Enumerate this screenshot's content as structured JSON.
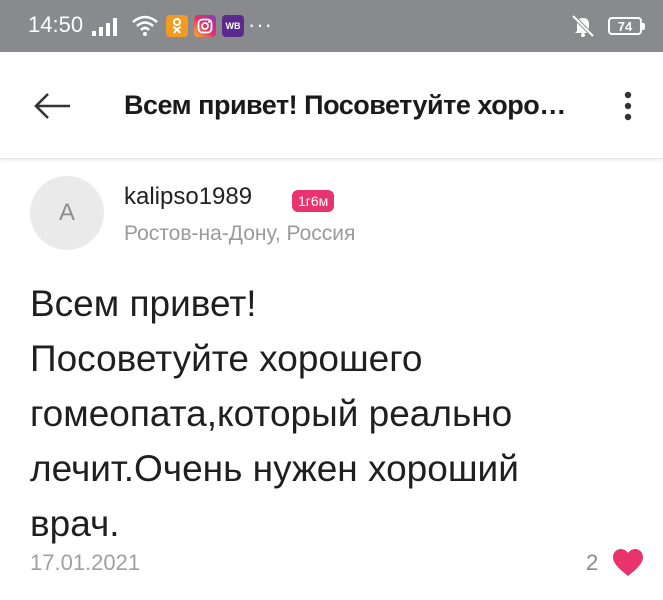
{
  "status_bar": {
    "time": "14:50",
    "app_icons": [
      "ok-app-icon",
      "instagram-icon",
      "wildberries-icon"
    ],
    "wb_label": "WB",
    "more": "···",
    "battery": "74"
  },
  "app_bar": {
    "title": "Всем привет! Посоветуйте хорошего гомеопата,который реально лечит.Очень нужен хороший врач."
  },
  "post": {
    "author": {
      "avatar_letter": "A",
      "username": "kalipso1989",
      "badge": "1г6м",
      "location": "Ростов-на-Дону, Россия"
    },
    "text_lines": [
      "Всем привет!",
      "Посоветуйте хорошего",
      "гомеопата,который реально",
      "лечит.Очень нужен хороший",
      "врач."
    ],
    "date": "17.01.2021",
    "likes": "2"
  },
  "colors": {
    "status_bar_bg": "#888a8d",
    "accent_pink": "#e8336d",
    "text_primary": "#1f1f1f",
    "text_secondary": "#9a9a9a"
  }
}
